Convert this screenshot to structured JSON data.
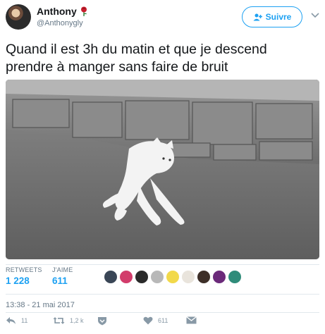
{
  "author": {
    "name": "Anthony",
    "handle": "@Anthonygly",
    "name_emoji": "rose-icon"
  },
  "follow_button": {
    "label": "Suivre",
    "icon": "add-user-icon"
  },
  "tweet": {
    "lines": [
      "Quand il est 3h du matin et que je descend",
      "prendre à manger sans faire de bruit"
    ]
  },
  "media": {
    "description_icon": "photo"
  },
  "stats": {
    "retweets_label": "RETWEETS",
    "retweets_value": "1 228",
    "likes_label": "J'AIME",
    "likes_value": "611"
  },
  "timestamp": "13:38 - 21 mai 2017",
  "actions": {
    "reply_count": "11",
    "retweet_count": "1,2 k",
    "like_count": "611"
  },
  "colors": {
    "accent": "#1da1f2",
    "muted": "#657786",
    "text": "#14171a",
    "border": "#e1e8ed"
  }
}
